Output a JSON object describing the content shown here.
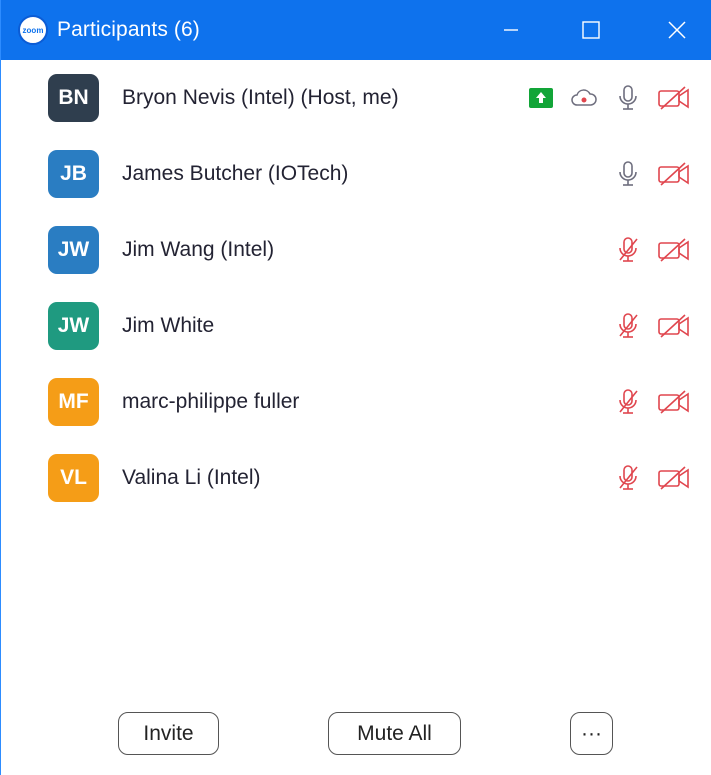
{
  "window": {
    "app_logo_text": "zoom",
    "title": "Participants (6)",
    "minimize_icon": "minimize-icon",
    "maximize_icon": "maximize-icon",
    "close_icon": "close-icon"
  },
  "participants": [
    {
      "initials": "BN",
      "name": "Bryon Nevis (Intel) (Host, me)",
      "avatar_color": "#2f3e4e",
      "share": true,
      "recording": true,
      "mic_muted": false,
      "video_off": true
    },
    {
      "initials": "JB",
      "name": "James Butcher (IOTech)",
      "avatar_color": "#2a7dc2",
      "share": false,
      "recording": false,
      "mic_muted": false,
      "video_off": true
    },
    {
      "initials": "JW",
      "name": "Jim Wang (Intel)",
      "avatar_color": "#2a7dc2",
      "share": false,
      "recording": false,
      "mic_muted": true,
      "video_off": true
    },
    {
      "initials": "JW",
      "name": "Jim White",
      "avatar_color": "#1f9a80",
      "share": false,
      "recording": false,
      "mic_muted": true,
      "video_off": true
    },
    {
      "initials": "MF",
      "name": "marc-philippe fuller",
      "avatar_color": "#f59d17",
      "share": false,
      "recording": false,
      "mic_muted": true,
      "video_off": true
    },
    {
      "initials": "VL",
      "name": "Valina Li (Intel)",
      "avatar_color": "#f59d17",
      "share": false,
      "recording": false,
      "mic_muted": true,
      "video_off": true
    }
  ],
  "footer": {
    "invite_label": "Invite",
    "mute_all_label": "Mute All",
    "more_label": "···"
  },
  "colors": {
    "titlebar": "#0e72ed",
    "muted_red": "#e0464e",
    "icon_gray": "#6e6e7e",
    "share_green": "#12a538"
  }
}
